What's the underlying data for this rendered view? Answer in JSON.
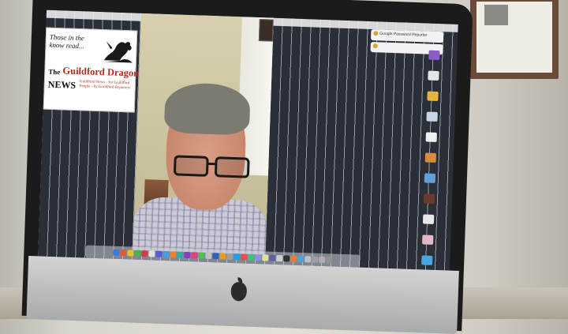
{
  "scene": {
    "description_free": true
  },
  "advert": {
    "tagline": "Those in the know read...",
    "the": "The",
    "brand": "Guildford Dragon",
    "news": "NEWS",
    "strapline": "Guildford News - for Guildford People - by Guildford Reporters",
    "brand_color": "#b42a20"
  },
  "notifications": [
    {
      "title": "Google Password Reporter",
      "icon": "password-icon"
    },
    {
      "title": "",
      "icon": "info-icon"
    }
  ],
  "desktop_icons": [
    {
      "label": "",
      "icon": "folder-icon",
      "color": "#8a5cc4"
    },
    {
      "label": "",
      "icon": "document-icon",
      "color": "#e5e5e5"
    },
    {
      "label": "",
      "icon": "folder-icon",
      "color": "#e9b43a"
    },
    {
      "label": "",
      "icon": "disk-icon",
      "color": "#c9d6e8"
    },
    {
      "label": "",
      "icon": "disk-icon",
      "color": "#f0f0f0"
    },
    {
      "label": "",
      "icon": "image-icon",
      "color": "#d98a3a"
    },
    {
      "label": "",
      "icon": "disk-icon",
      "color": "#5ea0d8"
    },
    {
      "label": "",
      "icon": "image-icon",
      "color": "#6b3a2a"
    },
    {
      "label": "",
      "icon": "document-icon",
      "color": "#e8e8e8"
    },
    {
      "label": "",
      "icon": "document-icon",
      "color": "#e0b8c8"
    },
    {
      "label": "",
      "icon": "folder-icon",
      "color": "#4aa6e0"
    }
  ],
  "dock_apps": [
    "#3a7be0",
    "#e05a3a",
    "#e0c03a",
    "#4ab04a",
    "#d04040",
    "#e0e0e0",
    "#5a5ae0",
    "#40a0e0",
    "#f08030",
    "#30b0a0",
    "#8040c0",
    "#e04080",
    "#50c050",
    "#c0c0c0",
    "#3060c0",
    "#e0a020",
    "#a0a0a0",
    "#20a0e0",
    "#e05050",
    "#40c080",
    "#9090e0",
    "#e0e0a0",
    "#6060a0",
    "#d0d0d0",
    "#303030",
    "#e08040",
    "#50a0e0",
    "#c0c0c0",
    "#a0a0a0",
    "#b0b0b0",
    "#909090"
  ]
}
